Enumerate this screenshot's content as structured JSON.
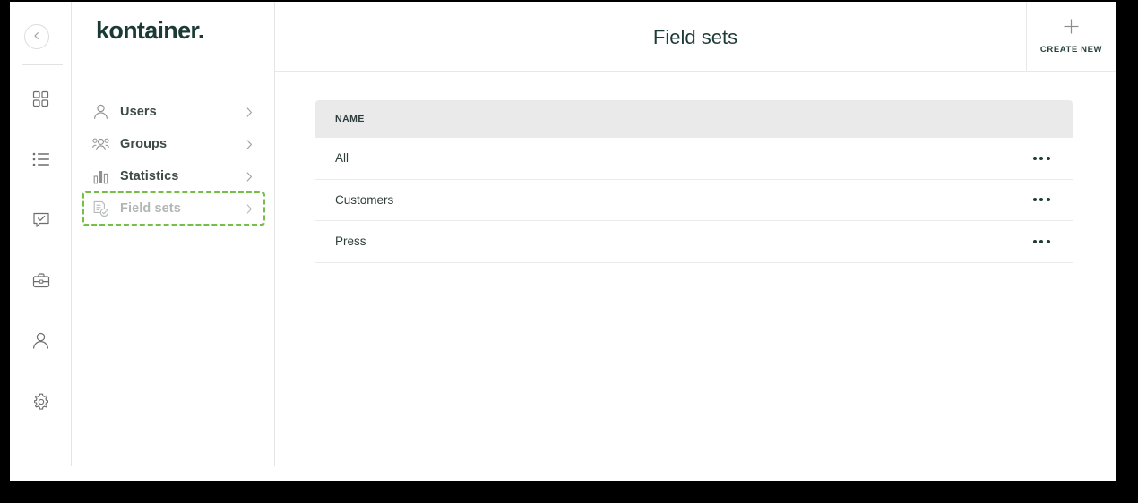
{
  "brand": {
    "logo_text": "kontainer.",
    "logo_color": "#1b3a35",
    "accent_highlight_color": "#76bf47"
  },
  "icon_rail": {
    "collapse_button": {
      "icon": "chevron-left-icon",
      "label": ""
    },
    "items": [
      {
        "icon": "grid-dashboard-icon",
        "name": "dashboard"
      },
      {
        "icon": "list-icon",
        "name": "list"
      },
      {
        "icon": "speech-bubble-check-icon",
        "name": "approvals"
      },
      {
        "icon": "briefcase-icon",
        "name": "portfolio"
      },
      {
        "icon": "user-icon",
        "name": "account"
      },
      {
        "icon": "gear-icon",
        "name": "settings"
      }
    ]
  },
  "sidebar": {
    "items": [
      {
        "label": "Users",
        "icon": "user-outline-icon",
        "chevron": "chevron-right-icon",
        "state": "normal"
      },
      {
        "label": "Groups",
        "icon": "users-group-icon",
        "chevron": "chevron-right-icon",
        "state": "normal"
      },
      {
        "label": "Statistics",
        "icon": "bar-chart-icon",
        "chevron": "chevron-right-icon",
        "state": "normal"
      },
      {
        "label": "Field sets",
        "icon": "document-check-icon",
        "chevron": "chevron-right-icon",
        "state": "dimmed-highlighted"
      }
    ]
  },
  "header": {
    "title": "Field sets",
    "create_new": {
      "label": "CREATE NEW",
      "icon": "plus-icon"
    }
  },
  "table": {
    "columns": [
      "NAME"
    ],
    "rows": [
      {
        "name": "All",
        "actions_icon": "ellipsis-icon"
      },
      {
        "name": "Customers",
        "actions_icon": "ellipsis-icon"
      },
      {
        "name": "Press",
        "actions_icon": "ellipsis-icon"
      }
    ]
  }
}
